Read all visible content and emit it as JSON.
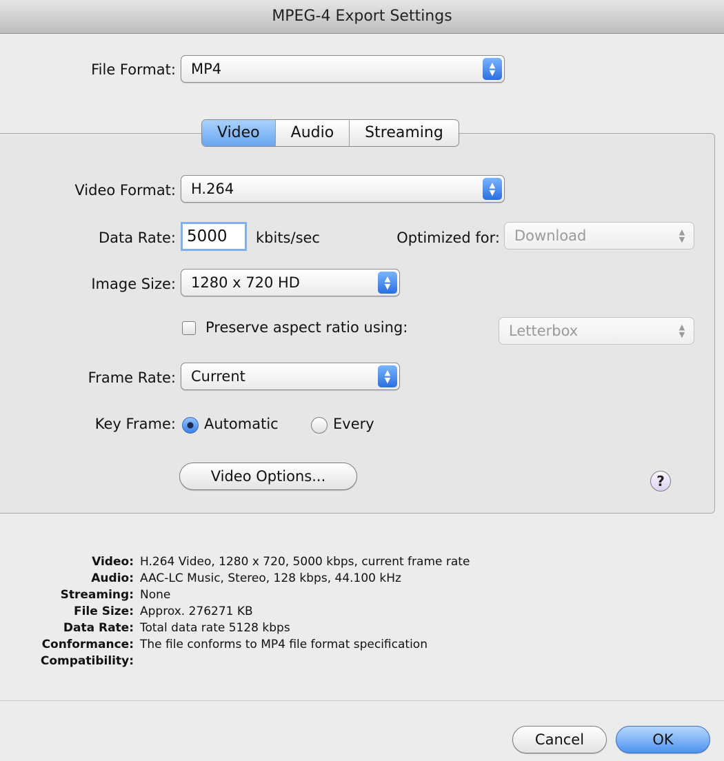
{
  "window": {
    "title": "MPEG-4 Export Settings"
  },
  "file_format": {
    "label": "File Format:",
    "value": "MP4"
  },
  "tabs": [
    {
      "label": "Video",
      "active": true
    },
    {
      "label": "Audio",
      "active": false
    },
    {
      "label": "Streaming",
      "active": false
    }
  ],
  "video": {
    "format_label": "Video Format:",
    "format_value": "H.264",
    "data_rate_label": "Data Rate:",
    "data_rate_value": "5000",
    "data_rate_unit": "kbits/sec",
    "optimized_label": "Optimized for:",
    "optimized_value": "Download",
    "image_size_label": "Image Size:",
    "image_size_value": "1280 x 720 HD",
    "preserve_label": "Preserve aspect ratio using:",
    "preserve_checked": false,
    "preserve_value": "Letterbox",
    "frame_rate_label": "Frame Rate:",
    "frame_rate_value": "Current",
    "key_frame_label": "Key Frame:",
    "key_frame_automatic": "Automatic",
    "key_frame_every": "Every",
    "options_button": "Video Options...",
    "help": "?"
  },
  "summary": {
    "video_key": "Video:",
    "video_val": "H.264 Video, 1280 x 720, 5000 kbps, current frame rate",
    "audio_key": "Audio:",
    "audio_val": "AAC-LC Music, Stereo, 128 kbps, 44.100 kHz",
    "streaming_key": "Streaming:",
    "streaming_val": "None",
    "filesize_key": "File Size:",
    "filesize_val": "Approx. 276271 KB",
    "datarate_key": "Data Rate:",
    "datarate_val": "Total data rate 5128 kbps",
    "conformance_key": "Conformance:",
    "conformance_val": "The file conforms to MP4 file format specification",
    "compat_key": "Compatibility:",
    "compat_val": ""
  },
  "buttons": {
    "cancel": "Cancel",
    "ok": "OK"
  },
  "colors": {
    "accent": "#4d93ef",
    "window_bg": "#ececec"
  }
}
